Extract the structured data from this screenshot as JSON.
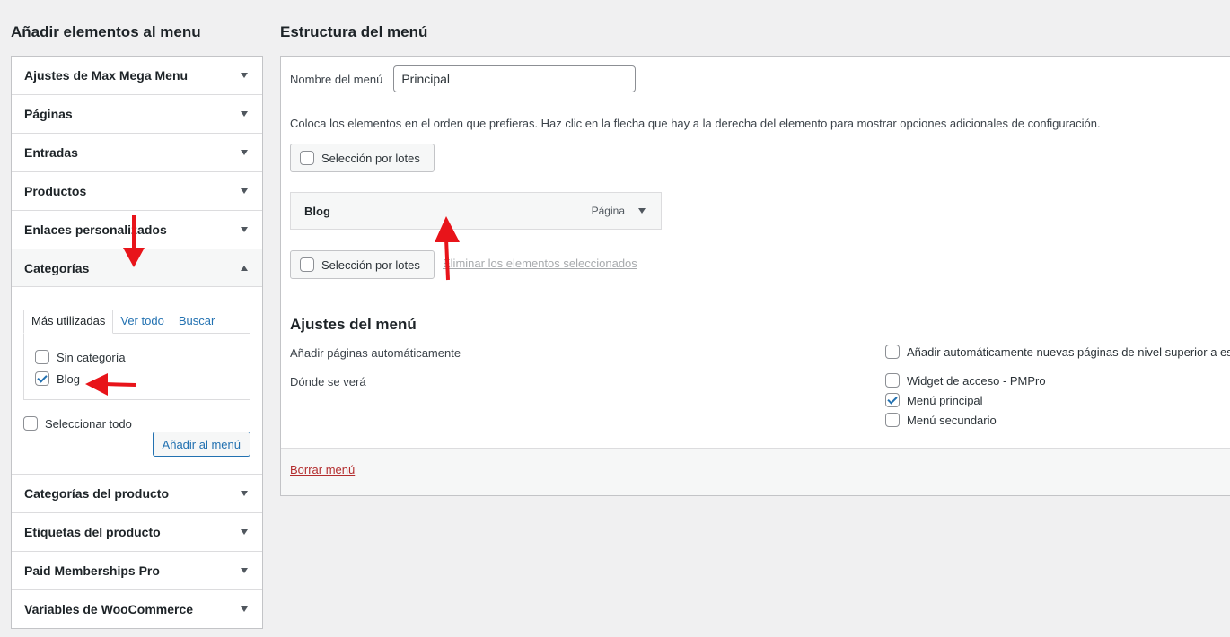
{
  "left": {
    "title": "Añadir elementos al menu",
    "sections_top": [
      {
        "label": "Ajustes de Max Mega Menu"
      },
      {
        "label": "Páginas"
      },
      {
        "label": "Entradas"
      },
      {
        "label": "Productos"
      },
      {
        "label": "Enlaces personalizados"
      }
    ],
    "categories": {
      "label": "Categorías",
      "tabs": [
        "Más utilizadas",
        "Ver todo",
        "Buscar"
      ],
      "items": [
        {
          "label": "Sin categoría",
          "checked": false
        },
        {
          "label": "Blog",
          "checked": true
        }
      ],
      "select_all": "Seleccionar todo",
      "add_button": "Añadir al menú"
    },
    "sections_bottom": [
      {
        "label": "Categorías del producto"
      },
      {
        "label": "Etiquetas del producto"
      },
      {
        "label": "Paid Memberships Pro"
      },
      {
        "label": "Variables de WooCommerce"
      }
    ]
  },
  "right": {
    "title": "Estructura del menú",
    "menu_name_label": "Nombre del menú",
    "menu_name_value": "Principal",
    "instructions": "Coloca los elementos en el orden que prefieras. Haz clic en la flecha que hay a la derecha del elemento para mostrar opciones adicionales de configuración.",
    "bulk_select": "Selección por lotes",
    "menu_item": {
      "title": "Blog",
      "type": "Página"
    },
    "remove_selected": "Eliminar los elementos seleccionados",
    "settings_title": "Ajustes del menú",
    "auto_add_label": "Añadir páginas automáticamente",
    "auto_add_option": "Añadir automáticamente nuevas páginas de nivel superior a este menú",
    "location_label": "Dónde se verá",
    "locations": [
      {
        "label": "Widget de acceso - PMPro",
        "checked": false
      },
      {
        "label": "Menú principal",
        "checked": true
      },
      {
        "label": "Menú secundario",
        "checked": false
      }
    ],
    "delete_menu": "Borrar menú"
  },
  "colors": {
    "accent": "#2271b1",
    "annotation": "#e8141a",
    "danger": "#b32d2e"
  }
}
